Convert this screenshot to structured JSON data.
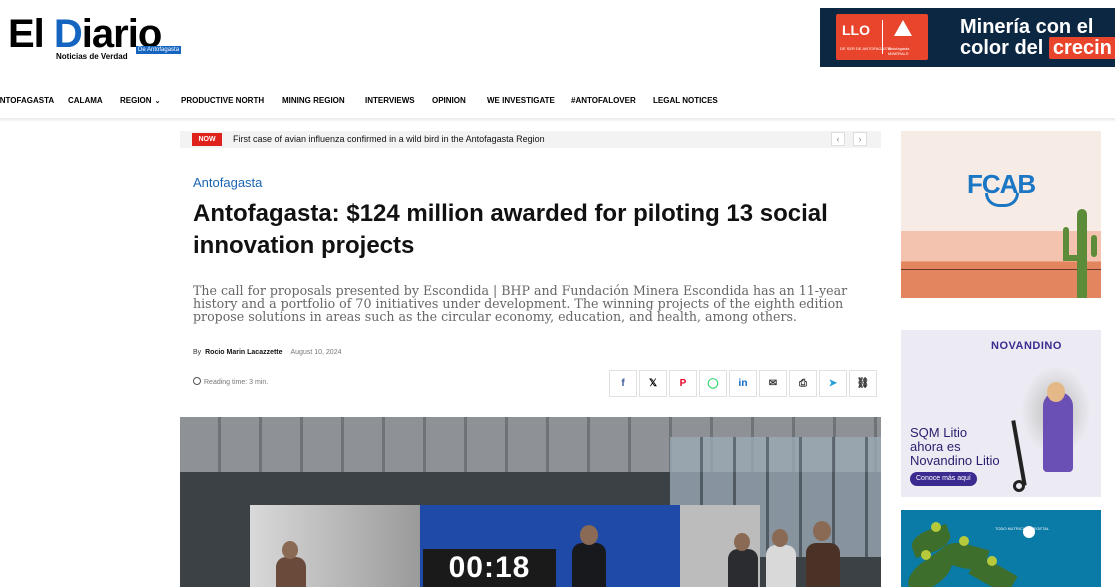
{
  "header": {
    "logo": {
      "word_el": "El ",
      "word_d": "D",
      "word_rest": "iario",
      "badge": "De Antofagasta",
      "tagline": "Noticias de Verdad"
    },
    "top_ad": {
      "badge_title": "LLO",
      "badge_left": "DE SER DE ANTOFAGASTA",
      "badge_right": "Antofagasta MINERALS",
      "line1": "Minería con el",
      "line2_lead": "color del",
      "line2_highlight": "crecin"
    }
  },
  "nav": {
    "items": [
      "ANTOFAGASTA",
      "CALAMA",
      "REGION",
      "PRODUCTIVE NORTH",
      "MINING REGION",
      "INTERVIEWS",
      "OPINION",
      "WE INVESTIGATE",
      "#ANTOFALOVER",
      "LEGAL NOTICES"
    ],
    "region_chevron": "⌄"
  },
  "ticker": {
    "badge": "NOW",
    "headline": "First case of avian influenza confirmed in a wild bird in the Antofagasta Region",
    "prev": "‹",
    "next": "›"
  },
  "article": {
    "category": "Antofagasta",
    "title": "Antofagasta: $124 million awarded for piloting 13 social innovation projects",
    "excerpt": "The call for proposals presented by Escondida | BHP and Fundación Minera Escondida has an 11-year history and a portfolio of 70 initiatives under development. The winning projects of the eighth edition propose solutions in areas such as the circular economy, education, and health, among others.",
    "by": "By",
    "author": "Rocio Marin Lacazzette",
    "date": "August 10, 2024",
    "reading_time": "Reading time: 3 min."
  },
  "share": {
    "facebook": "f",
    "x": "𝕏",
    "pinterest": "P",
    "whatsapp": "◯",
    "linkedin": "in",
    "email": "✉",
    "print": "⎙",
    "telegram": "➤",
    "copy": "⛓"
  },
  "hero": {
    "countdown": "00:18"
  },
  "sidebar": {
    "ad1": {
      "brand": "FCAB"
    },
    "ad2": {
      "brand": "NOVANDINO",
      "copy_line1": "SQM Litio",
      "copy_line2": "ahora es",
      "copy_line3": "Novandino Litio",
      "cta": "Conoce más aquí"
    },
    "ad3": {
      "tag": "TODO NUTRICIÓN VEGETAL"
    }
  },
  "colors": {
    "accent": "#1a64b4",
    "now_badge": "#e0221c",
    "ad_orange": "#e8452c"
  }
}
